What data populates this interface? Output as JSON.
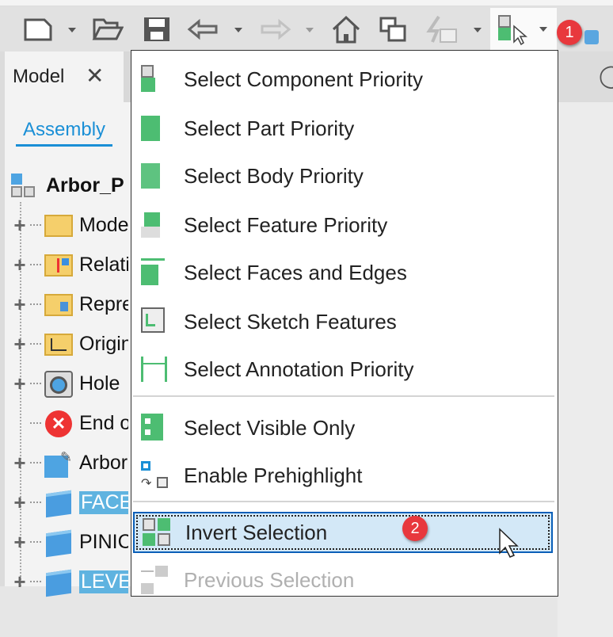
{
  "toolbar": {
    "buttons": [
      {
        "icon": "new-file-icon"
      },
      {
        "icon": "open-folder-icon"
      },
      {
        "icon": "save-icon"
      },
      {
        "icon": "undo-icon"
      },
      {
        "icon": "redo-icon"
      },
      {
        "icon": "home-icon"
      },
      {
        "icon": "windows-icon"
      },
      {
        "icon": "update-icon"
      },
      {
        "icon": "select-priority-icon"
      }
    ],
    "badge1": "1"
  },
  "panel": {
    "tab_label": "Model",
    "close": "✕",
    "subtab": "Assembly"
  },
  "tree": {
    "root": "Arbor_P",
    "items": [
      {
        "label": "Mode",
        "icon": "folder-icon"
      },
      {
        "label": "Relati",
        "icon": "relationships-folder-icon"
      },
      {
        "label": "Repre",
        "icon": "representations-folder-icon"
      },
      {
        "label": "Origin",
        "icon": "origin-folder-icon"
      },
      {
        "label": "Hole",
        "icon": "hole-icon"
      },
      {
        "label": "End o",
        "icon": "end-of-features-icon"
      },
      {
        "label": "Arbor",
        "icon": "grounded-part-icon"
      },
      {
        "label": "FACE",
        "icon": "part-icon",
        "selected": true
      },
      {
        "label": "PINIC",
        "icon": "part-icon"
      },
      {
        "label": "LEVEL",
        "icon": "part-icon",
        "selected": true
      }
    ]
  },
  "menu": {
    "items": [
      {
        "label": "Select Component Priority"
      },
      {
        "label": "Select Part Priority"
      },
      {
        "label": "Select Body Priority"
      },
      {
        "label": "Select Feature Priority"
      },
      {
        "label": "Select Faces and Edges"
      },
      {
        "label": "Select Sketch Features"
      },
      {
        "label": "Select Annotation Priority"
      },
      {
        "label": "Select Visible Only"
      },
      {
        "label": "Enable Prehighlight"
      },
      {
        "label": "Invert Selection"
      },
      {
        "label": "Previous Selection"
      }
    ],
    "badge2": "2"
  },
  "colors": {
    "accent": "#1a8fd6",
    "green": "#4dbd72",
    "highlight": "#d3e8f7",
    "badge": "#e8383d"
  }
}
